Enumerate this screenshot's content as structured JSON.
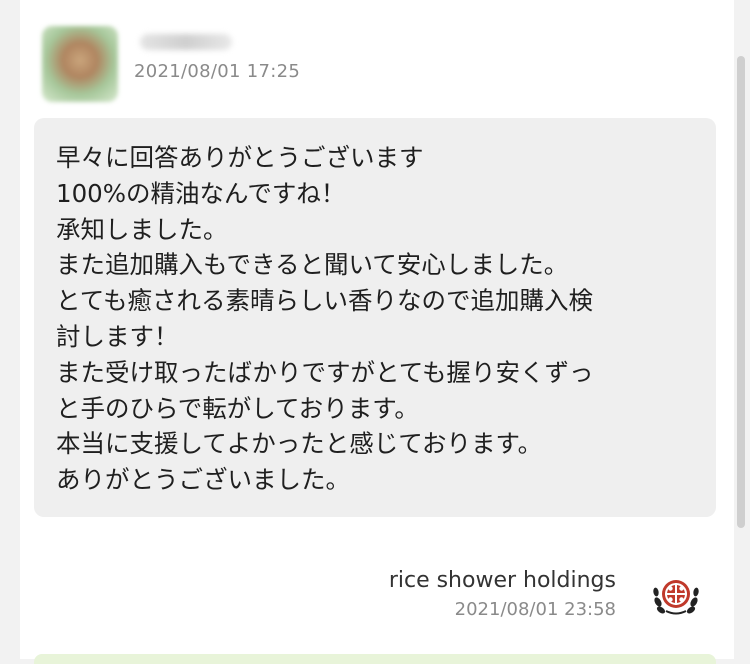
{
  "message_received": {
    "timestamp": "2021/08/01 17:25",
    "lines": [
      "早々に回答ありがとうございます",
      "100%の精油なんですね！",
      "承知しました。",
      "また追加購入もできると聞いて安心しました。",
      "とても癒される素晴らしい香りなので追加購入検",
      "討します！",
      "また受け取ったばかりですがとても握り安くずっ",
      "と手のひらで転がしております。",
      "本当に支援してよかったと感じております。",
      "ありがとうございました。"
    ]
  },
  "message_sent": {
    "sender_name": "rice shower holdings",
    "timestamp": "2021/08/01 23:58"
  },
  "colors": {
    "received_bubble": "#efefef",
    "sent_bubble": "#e8f4d9",
    "logo_red": "#c0392b"
  },
  "icons": {
    "sender_avatar": "blurred-user-avatar",
    "company_logo": "laurel-crest-logo"
  }
}
